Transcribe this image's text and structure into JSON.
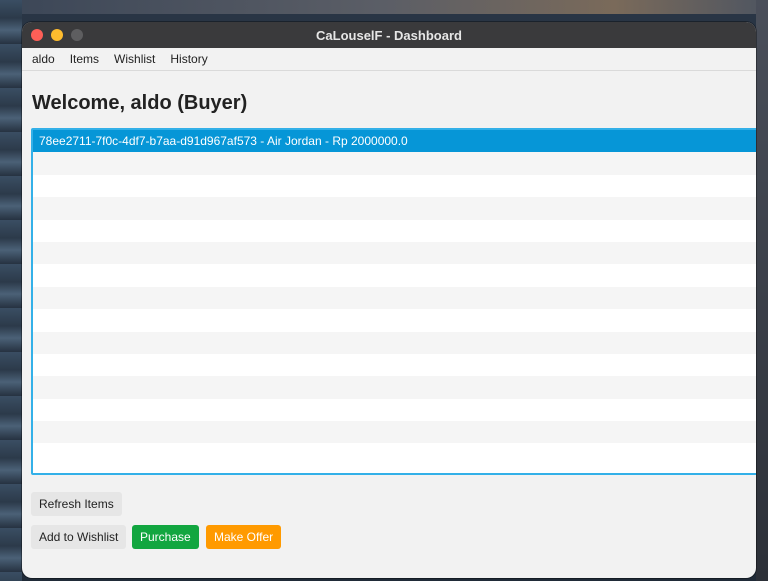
{
  "window": {
    "title": "CaLouselF - Dashboard"
  },
  "menu": [
    "aldo",
    "Items",
    "Wishlist",
    "History"
  ],
  "heading": "Welcome, aldo (Buyer)",
  "items_list": {
    "items": [
      "78ee2711-7f0c-4df7-b7aa-d91d967af573 - Air Jordan - Rp 2000000.0"
    ],
    "selected_index": 0
  },
  "buttons": {
    "refresh": "Refresh Items",
    "add_wishlist": "Add to Wishlist",
    "purchase": "Purchase",
    "make_offer": "Make Offer"
  },
  "colors": {
    "selection": "#0696d7",
    "purchase": "#12a640",
    "make_offer": "#ff9a00",
    "focus_border": "#33b0e8"
  }
}
